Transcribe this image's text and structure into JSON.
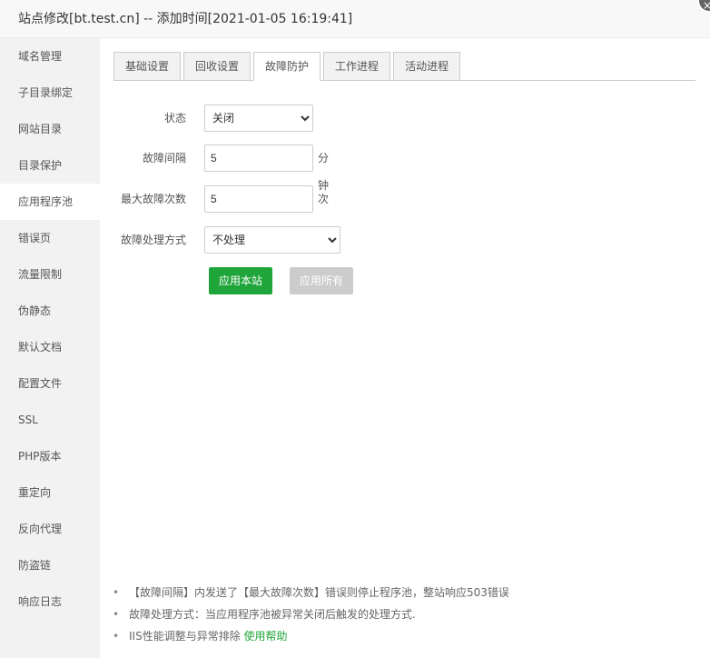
{
  "title": "站点修改[bt.test.cn] -- 添加时间[2021-01-05 16:19:41]",
  "close_icon": "×",
  "sidebar": [
    "域名管理",
    "子目录绑定",
    "网站目录",
    "目录保护",
    "应用程序池",
    "错误页",
    "流量限制",
    "伪静态",
    "默认文档",
    "配置文件",
    "SSL",
    "PHP版本",
    "重定向",
    "反向代理",
    "防盗链",
    "响应日志"
  ],
  "tabs": [
    "基础设置",
    "回收设置",
    "故障防护",
    "工作进程",
    "活动进程"
  ],
  "form": {
    "status_label": "状态",
    "status_value": "关闭",
    "interval_label": "故障间隔",
    "interval_value": "5",
    "interval_unit": "分钟",
    "max_label": "最大故障次数",
    "max_value": "5",
    "max_unit": "次",
    "mode_label": "故障处理方式",
    "mode_value": "不处理"
  },
  "buttons": {
    "apply_site": "应用本站",
    "apply_all": "应用所有"
  },
  "colors": {
    "primary": "#20a53a",
    "disabled": "#cccccc"
  },
  "notes": [
    "【故障间隔】内发送了【最大故障次数】错误则停止程序池，整站响应503错误",
    "故障处理方式：当应用程序池被异常关闭后触发的处理方式.",
    "IIS性能调整与异常排除 "
  ],
  "help_link": "使用帮助"
}
